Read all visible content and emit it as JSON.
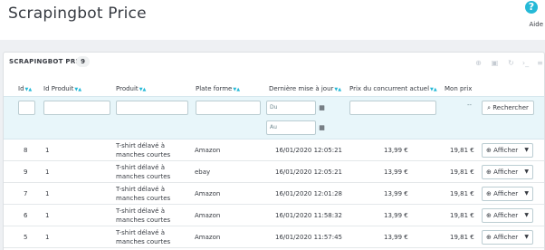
{
  "header": {
    "title": "Scrapingbot Price",
    "help_icon": "?",
    "help_label": "Aide"
  },
  "panel": {
    "title": "SCRAPINGBOT PRICE",
    "count": "9",
    "tools": [
      "add-icon",
      "export-icon",
      "refresh-icon",
      "sql-icon",
      "database-icon"
    ]
  },
  "columns": [
    {
      "label": "Id",
      "sortable": true
    },
    {
      "label": "Id Produit",
      "sortable": true
    },
    {
      "label": "Produit",
      "sortable": true
    },
    {
      "label": "Plate forme",
      "sortable": true
    },
    {
      "label": "Dernière mise à jour",
      "sortable": true
    },
    {
      "label": "Prix du concurrent actuel",
      "sortable": true
    },
    {
      "label": "Mon prix",
      "sortable": false
    }
  ],
  "filters": {
    "date_from_placeholder": "Du",
    "date_to_placeholder": "Au",
    "mon_prix_placeholder": "--",
    "search_label": "Rechercher"
  },
  "rows": [
    {
      "id": "8",
      "id_produit": "1",
      "produit": "T-shirt délavé à manches courtes",
      "plateforme": "Amazon",
      "date": "16/01/2020 12:05:21",
      "prix_concurrent": "13,99 €",
      "mon_prix": "19,81 €",
      "action": "Afficher"
    },
    {
      "id": "9",
      "id_produit": "1",
      "produit": "T-shirt délavé à manches courtes",
      "plateforme": "ebay",
      "date": "16/01/2020 12:05:21",
      "prix_concurrent": "13,99 €",
      "mon_prix": "19,81 €",
      "action": "Afficher"
    },
    {
      "id": "7",
      "id_produit": "1",
      "produit": "T-shirt délavé à manches courtes",
      "plateforme": "Amazon",
      "date": "16/01/2020 12:01:28",
      "prix_concurrent": "13,99 €",
      "mon_prix": "19,81 €",
      "action": "Afficher"
    },
    {
      "id": "6",
      "id_produit": "1",
      "produit": "T-shirt délavé à manches courtes",
      "plateforme": "Amazon",
      "date": "16/01/2020 11:58:32",
      "prix_concurrent": "13,99 €",
      "mon_prix": "19,81 €",
      "action": "Afficher"
    },
    {
      "id": "5",
      "id_produit": "1",
      "produit": "T-shirt délavé à manches courtes",
      "plateforme": "Amazon",
      "date": "16/01/2020 11:57:45",
      "prix_concurrent": "13,99 €",
      "mon_prix": "19,81 €",
      "action": "Afficher"
    }
  ],
  "colors": {
    "accent": "#25b9d7",
    "filter_bg": "#e8f6fa",
    "page_bg": "#eef0f3"
  }
}
